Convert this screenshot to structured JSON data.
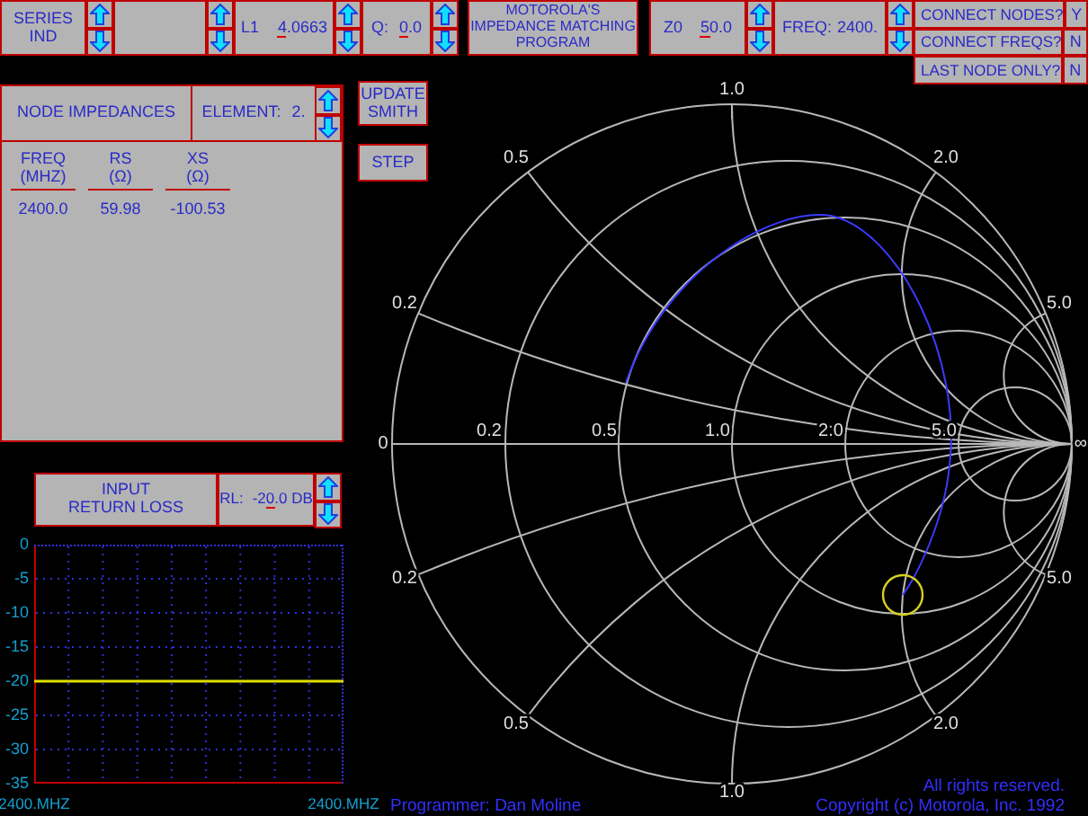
{
  "top_bar": {
    "element_type": "SERIES\nIND",
    "inductor": {
      "label": "L1",
      "value_parts": [
        {
          "text": "4",
          "cursor": true
        },
        {
          "text": ".0663",
          "cursor": false
        }
      ]
    },
    "q": {
      "label": "Q:",
      "value_parts": [
        {
          "text": "0",
          "cursor": true
        },
        {
          "text": ".0",
          "cursor": false
        }
      ]
    },
    "title": "MOTOROLA'S\nIMPEDANCE MATCHING\nPROGRAM",
    "z0": {
      "label": "Z0",
      "value_parts": [
        {
          "text": "5",
          "cursor": true
        },
        {
          "text": "0.0",
          "cursor": false
        }
      ]
    },
    "freq": {
      "label": "FREQ:",
      "value": "2400."
    },
    "options": [
      {
        "label": "CONNECT NODES?",
        "value": "Y"
      },
      {
        "label": "CONNECT FREQS?",
        "value": "N"
      },
      {
        "label": "LAST NODE ONLY?",
        "value": "N"
      }
    ]
  },
  "node_impedances": {
    "title": "NODE IMPEDANCES",
    "element": {
      "label": "ELEMENT:",
      "value": "2."
    },
    "columns": [
      "FREQ\n(MHZ)",
      "RS\n(Ω)",
      "XS\n(Ω)"
    ],
    "rows": [
      [
        "2400.0",
        "59.98",
        "-100.53"
      ]
    ]
  },
  "buttons": [
    "UPDATE\nSMITH",
    "STEP"
  ],
  "return_loss": {
    "title": "INPUT\nRETURN LOSS",
    "label": "RL:",
    "value_parts": [
      {
        "text": "-2",
        "cursor": false
      },
      {
        "text": "0",
        "cursor": true
      },
      {
        "text": ".0 DB",
        "cursor": false
      }
    ],
    "chart_data": {
      "type": "line",
      "categories": [
        "2400.MHZ",
        null,
        null,
        null,
        null,
        null,
        null,
        null,
        null,
        "2400.MHZ"
      ],
      "grid": true,
      "series": [
        {
          "color": "#e0e000",
          "values": [
            -20,
            -20,
            -20,
            -20,
            -20,
            -20,
            -20,
            -20,
            -20,
            -20
          ]
        }
      ],
      "ylim": [
        -35,
        0
      ],
      "yticks": [
        0,
        -5,
        -10,
        -15,
        -20,
        -25,
        -30,
        -35
      ]
    }
  },
  "smith_chart": {
    "labels": [
      "1.0",
      "0.5",
      "2.0",
      "0.2",
      "5.0",
      "0",
      "0.2",
      "0.5",
      "1.0",
      "2.0",
      "5.0",
      "∞",
      "0.2",
      "5.0",
      "0.5",
      "2.0",
      "1.0"
    ]
  },
  "footer": {
    "programmer": "Programmer: Dan Moline",
    "rights": "All rights reserved.",
    "copyright": "Copyright (c) Motorola, Inc. 1992"
  }
}
